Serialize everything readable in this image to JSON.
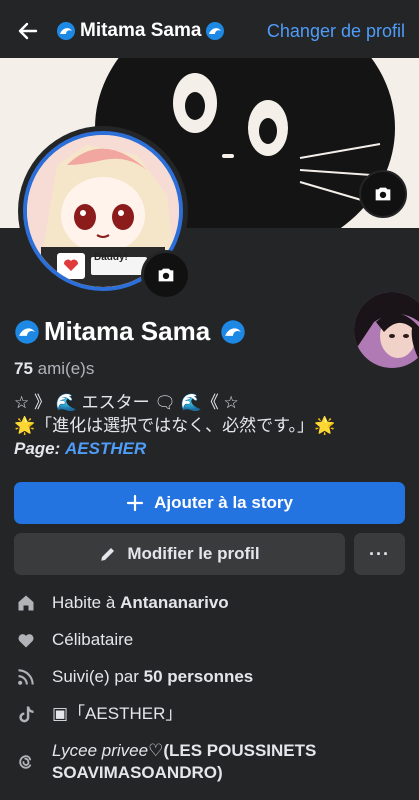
{
  "header": {
    "title": "Mitama Sama",
    "action_label": "Changer de profil"
  },
  "profile": {
    "name": "Mitama Sama",
    "friends_count": "75",
    "friends_label": "ami(e)s",
    "bio_line1": "☆ 》 🌊 エスター 🗨 🌊《 ☆",
    "bio_line2": "🌟「進化は選択ではなく、必然です。」🌟",
    "page_label": "Page:",
    "page_name": "AESTHER",
    "avatar_caption": "Daddy!"
  },
  "buttons": {
    "add_story": "Ajouter à la story",
    "edit_profile": "Modifier le profil",
    "more": "···"
  },
  "details": {
    "lives_prefix": "Habite à",
    "lives_city": "Antananarivo",
    "relationship": "Célibataire",
    "followers_prefix": "Suivi(e) par",
    "followers_count": "50 personnes",
    "tiktok": "▣「AESTHER」",
    "school_prefix": "Lycee privee♡",
    "school_name": "(LES POUSSINETS SOAVIMASOANDRO)"
  },
  "colors": {
    "accent": "#2374e1",
    "link": "#4f9cf9",
    "background": "#242526",
    "button_secondary": "#3a3b3c"
  }
}
